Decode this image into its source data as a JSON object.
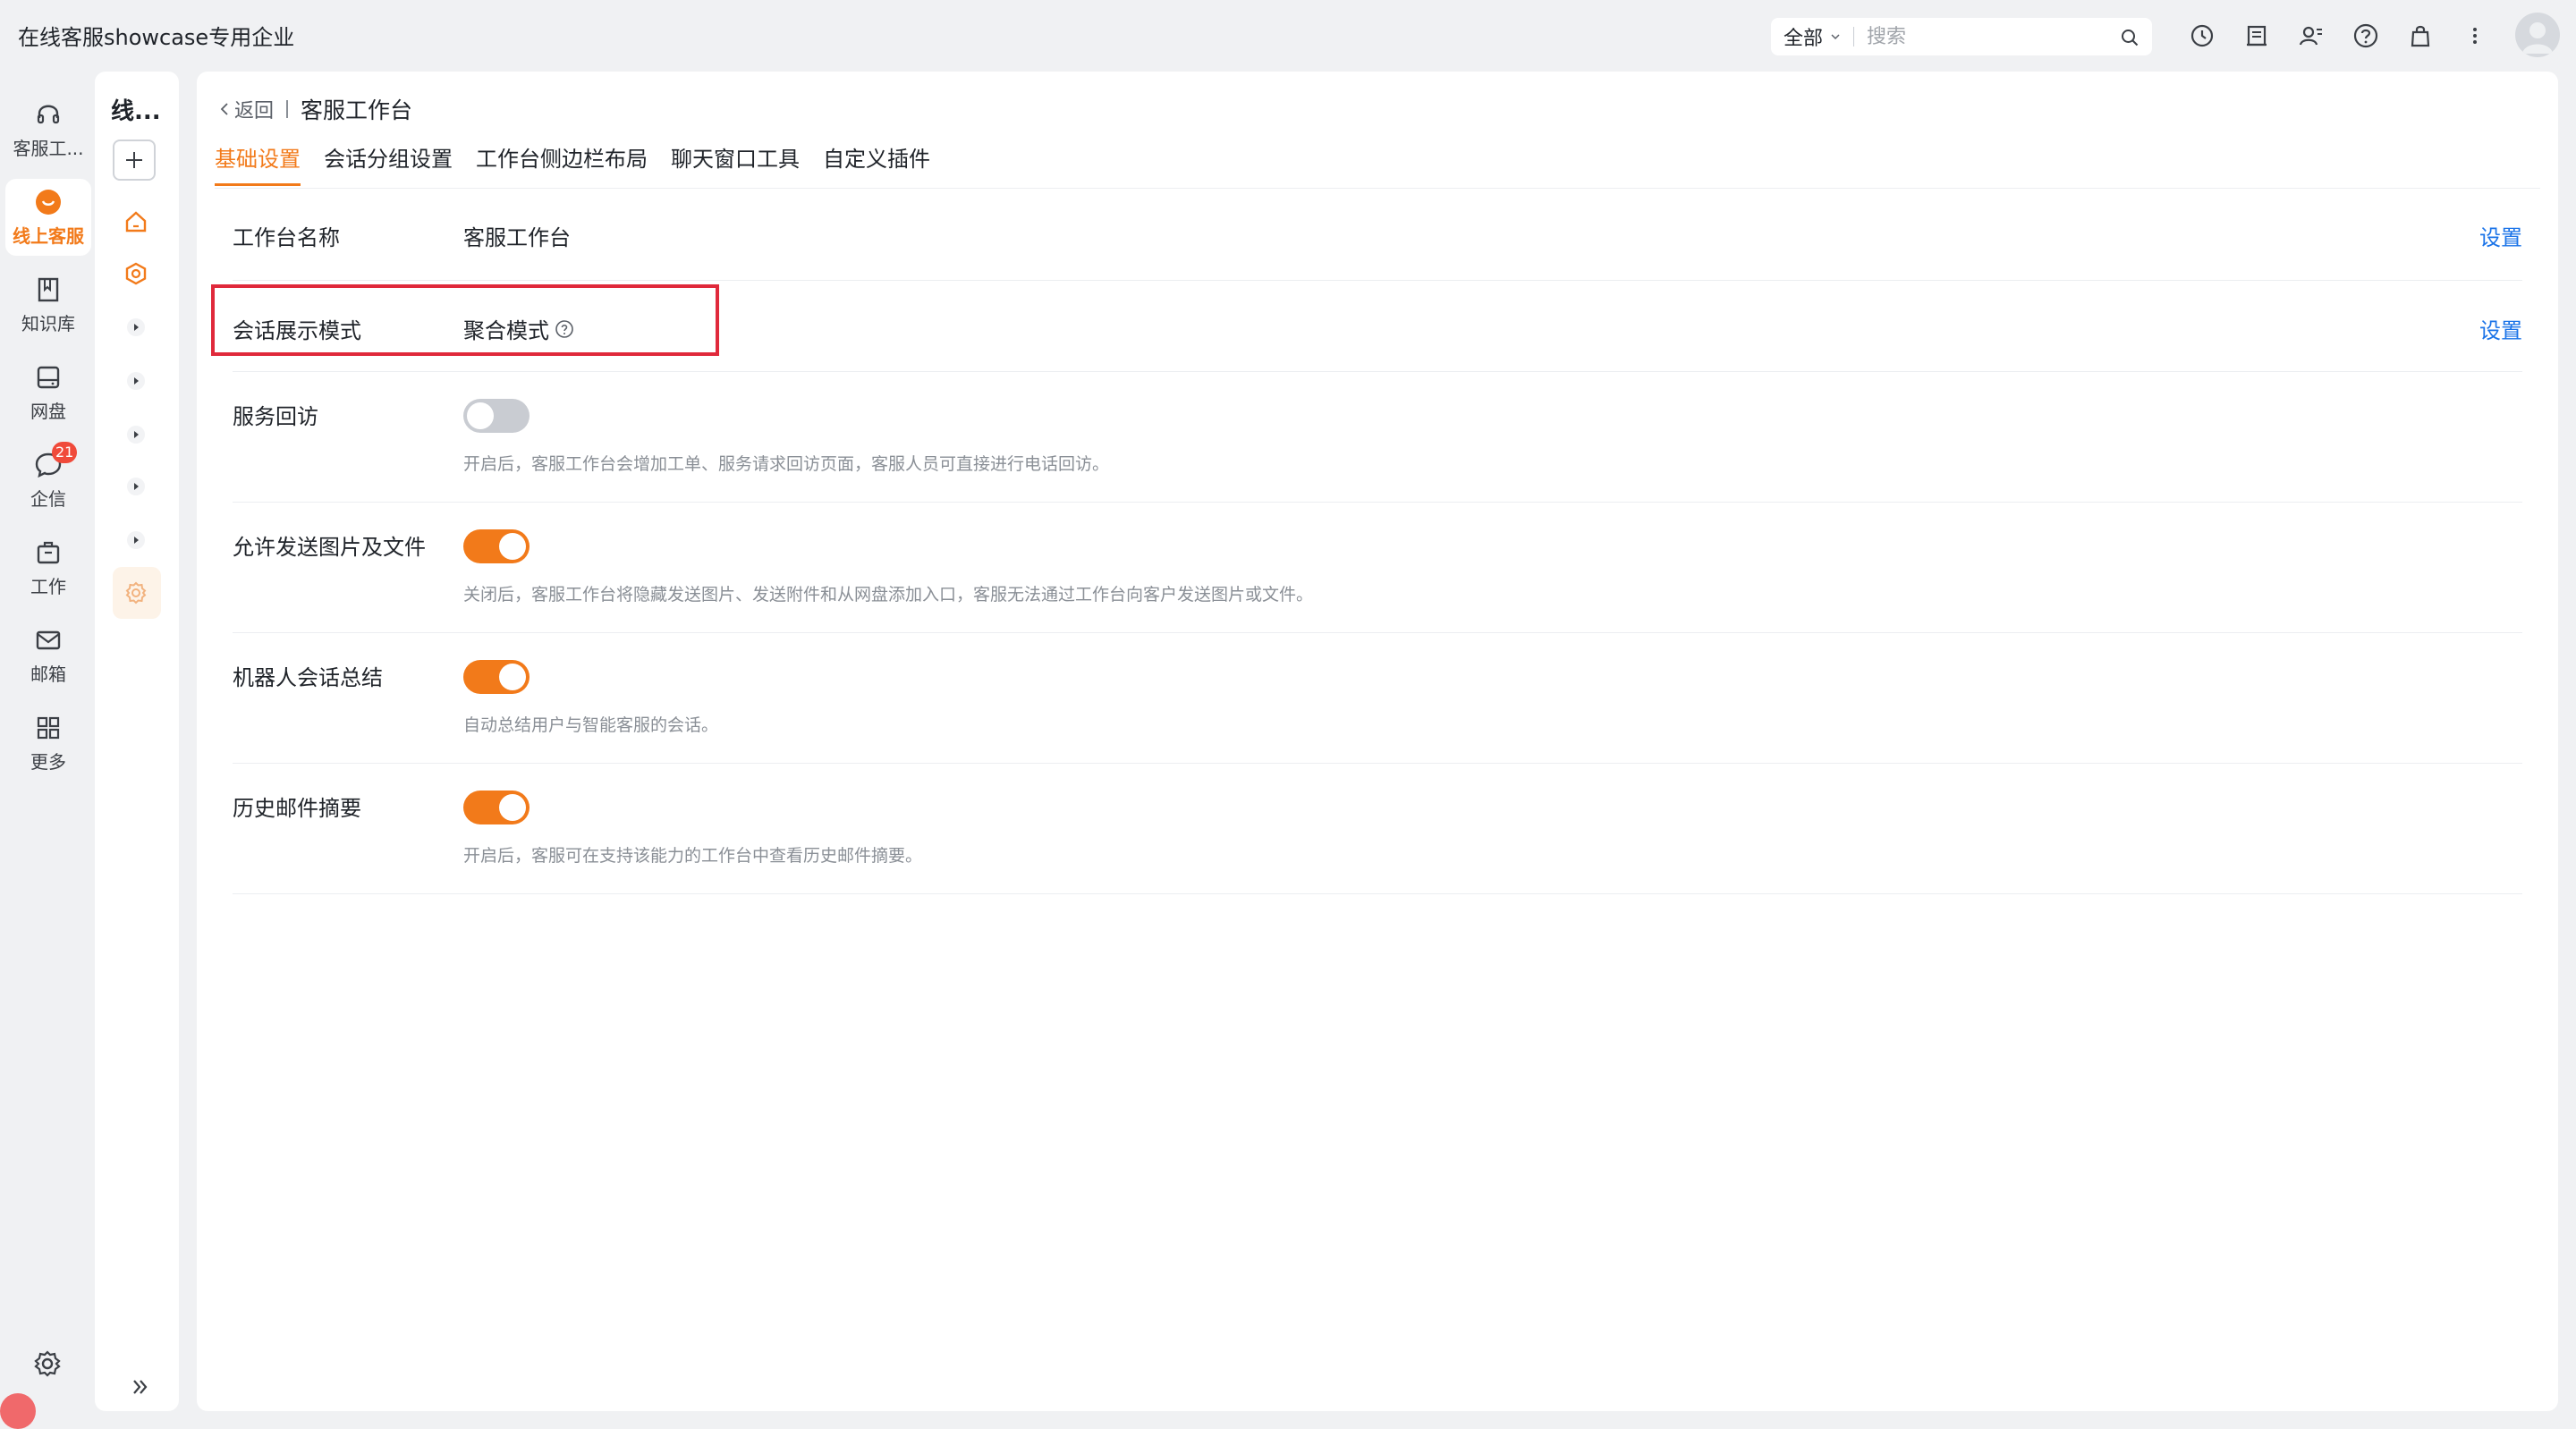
{
  "app": {
    "title": "在线客服showcase专用企业"
  },
  "search": {
    "scope": "全部",
    "placeholder": "搜索"
  },
  "top_icons": [
    "clock-icon",
    "document-icon",
    "contacts-icon",
    "help-circle-icon",
    "bag-icon",
    "more-vertical-icon"
  ],
  "rail": {
    "items": [
      {
        "label": "客服工...",
        "icon": "headset-icon"
      },
      {
        "label": "线上客服",
        "icon": "chat-bubble-icon",
        "active": true
      },
      {
        "label": "知识库",
        "icon": "book-icon"
      },
      {
        "label": "网盘",
        "icon": "drive-icon"
      },
      {
        "label": "企信",
        "icon": "message-icon",
        "badge": "21"
      },
      {
        "label": "工作",
        "icon": "briefcase-icon"
      },
      {
        "label": "邮箱",
        "icon": "mail-icon"
      },
      {
        "label": "更多",
        "icon": "grid-icon"
      }
    ]
  },
  "rail2": {
    "title": "线..."
  },
  "breadcrumb": {
    "back": "返回",
    "current": "客服工作台"
  },
  "tabs": [
    "基础设置",
    "会话分组设置",
    "工作台侧边栏布局",
    "聊天窗口工具",
    "自定义插件"
  ],
  "settings": {
    "name": {
      "label": "工作台名称",
      "value": "客服工作台",
      "action": "设置"
    },
    "mode": {
      "label": "会话展示模式",
      "value": "聚合模式",
      "action": "设置"
    },
    "followup": {
      "label": "服务回访",
      "enabled": false,
      "desc": "开启后，客服工作台会增加工单、服务请求回访页面，客服人员可直接进行电话回访。"
    },
    "files": {
      "label": "允许发送图片及文件",
      "enabled": true,
      "desc": "关闭后，客服工作台将隐藏发送图片、发送附件和从网盘添加入口，客服无法通过工作台向客户发送图片或文件。"
    },
    "summary": {
      "label": "机器人会话总结",
      "enabled": true,
      "desc": "自动总结用户与智能客服的会话。"
    },
    "mail": {
      "label": "历史邮件摘要",
      "enabled": true,
      "desc": "开启后，客服可在支持该能力的工作台中查看历史邮件摘要。"
    }
  },
  "colors": {
    "accent": "#f27a1a",
    "link": "#1a73e8",
    "highlight": "#e0293b",
    "badge": "#f04a3a"
  }
}
